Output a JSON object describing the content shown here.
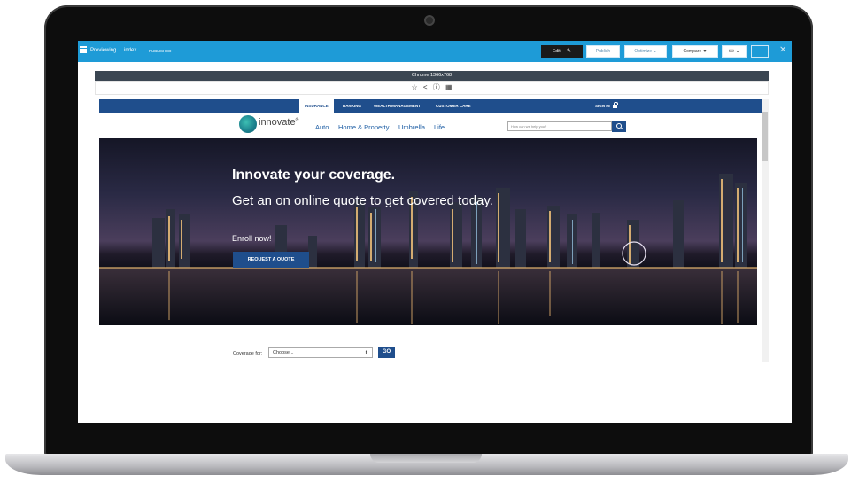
{
  "app": {
    "status_label": "Previewing",
    "variant_label": "index",
    "state_label": "PUBLISHED",
    "edit_label": "Edit",
    "publish_label": "Publish",
    "optimize_label": "Optimize",
    "compare_label": "Compare"
  },
  "device": {
    "label": "Chrome 1366x768"
  },
  "site": {
    "top_nav": [
      "INSURANCE",
      "BANKING",
      "WEALTH MANAGEMENT",
      "CUSTOMER CARE"
    ],
    "sign_in": "SIGN IN",
    "logo_text": "innovate",
    "sub_nav": [
      "Auto",
      "Home & Property",
      "Umbrella",
      "Life"
    ],
    "search_placeholder": "How can we help you?",
    "hero": {
      "title": "Innovate your coverage.",
      "subtitle": "Get an on online quote to get covered today.",
      "enroll": "Enroll now!",
      "cta": "REQUEST A QUOTE"
    },
    "coverage": {
      "label": "Coverage for:",
      "selected": "Choose...",
      "go": "GO"
    }
  },
  "colors": {
    "app_bar": "#1e9bd7",
    "site_primary": "#1f4e8c"
  }
}
